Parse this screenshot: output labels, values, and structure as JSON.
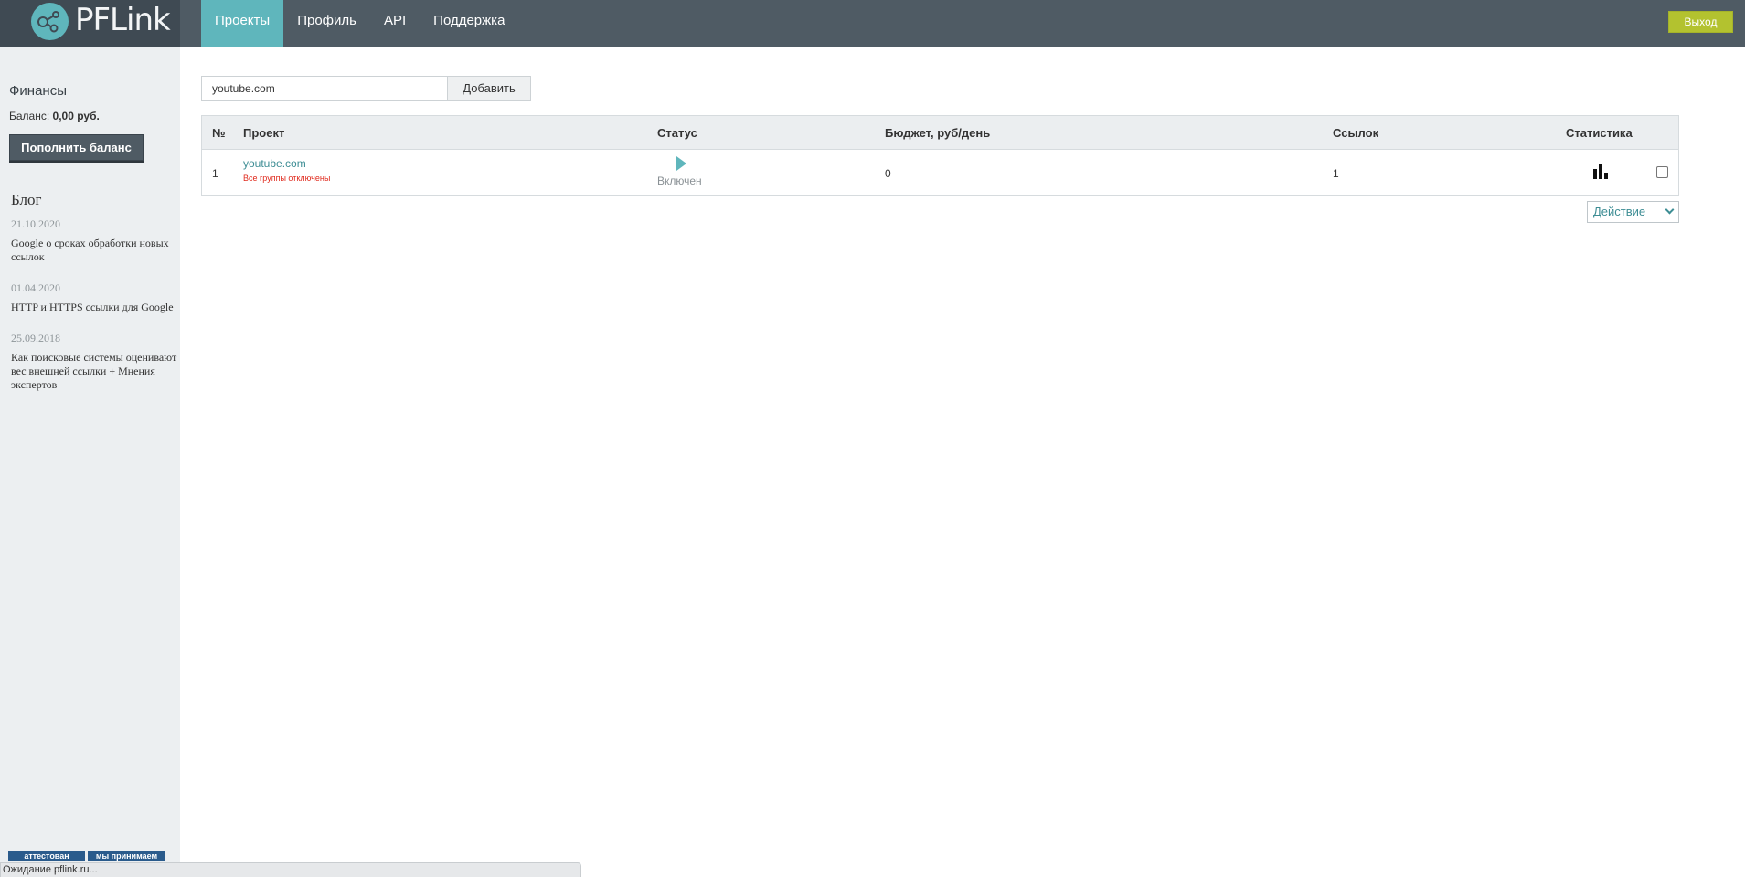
{
  "header": {
    "logo_text": "PFLink",
    "nav": [
      "Проекты",
      "Профиль",
      "API",
      "Поддержка"
    ],
    "logout_label": "Выход"
  },
  "sidebar": {
    "finance_title": "Финансы",
    "balance_label": "Баланс:",
    "balance_value": "0,00 руб.",
    "topup_label": "Пополнить баланс",
    "blog_title": "Блог",
    "posts": [
      {
        "date": "21.10.2020",
        "title": "Google о сроках обработки новых ссылок"
      },
      {
        "date": "01.04.2020",
        "title": "HTTP и HTTPS ссылки для Google"
      },
      {
        "date": "25.09.2018",
        "title": "Как поисковые системы оценивают вес внешней ссылки + Мнения экспертов"
      }
    ],
    "badges": [
      "аттестован",
      "мы принимаем"
    ]
  },
  "add_form": {
    "input_value": "youtube.com",
    "add_label": "Добавить"
  },
  "table": {
    "headers": [
      "№",
      "Проект",
      "Статус",
      "Бюджет, руб/день",
      "Ссылок",
      "Статистика"
    ],
    "rows": [
      {
        "num": "1",
        "project": "youtube.com",
        "note": "Все группы отключены",
        "status": "Включен",
        "budget": "0",
        "links": "1"
      }
    ]
  },
  "action_select": {
    "selected": "Действие"
  },
  "statusbar": {
    "text": "Ожидание pflink.ru..."
  },
  "colors": {
    "accent": "#5fb6bc",
    "header": "#4f5b64",
    "logout": "#b3c22f",
    "error": "#e0291c"
  }
}
